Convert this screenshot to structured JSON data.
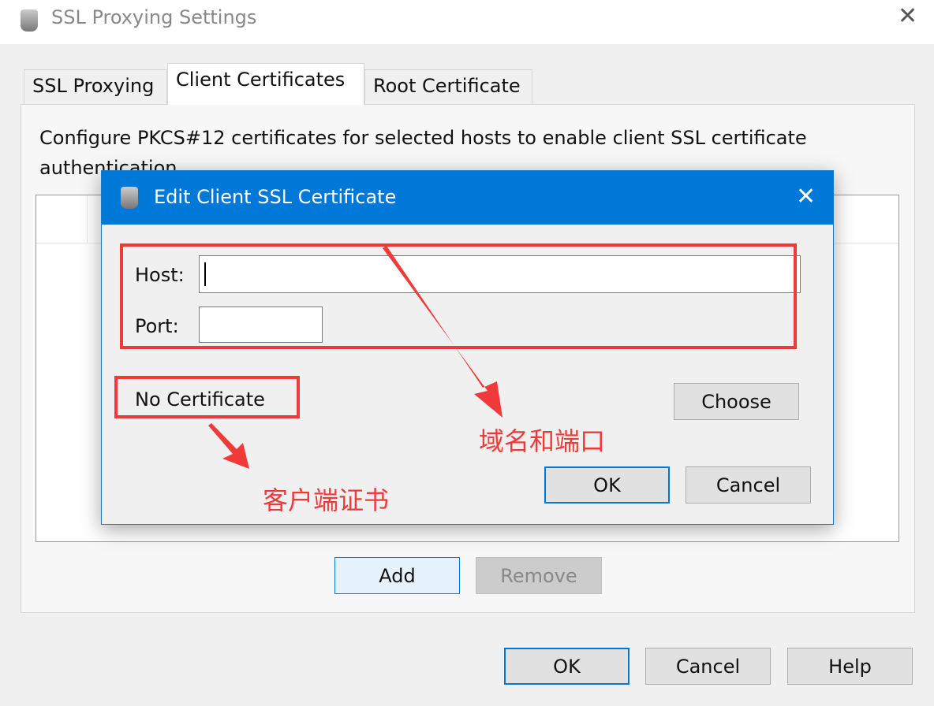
{
  "window": {
    "title": "SSL Proxying Settings",
    "icon": "charles-jug-icon",
    "close_icon": "close-icon"
  },
  "tabs": [
    {
      "label": "SSL Proxying"
    },
    {
      "label": "Client Certificates",
      "active": true
    },
    {
      "label": "Root Certificate"
    }
  ],
  "panel": {
    "description": "Configure PKCS#12 certificates for selected hosts to enable client SSL certificate authentication.",
    "add_label": "Add",
    "remove_label": "Remove"
  },
  "footer": {
    "ok_label": "OK",
    "cancel_label": "Cancel",
    "help_label": "Help"
  },
  "dialog": {
    "title": "Edit Client SSL Certificate",
    "host_label": "Host:",
    "host_value": "",
    "port_label": "Port:",
    "port_value": "",
    "certificate_status": "No Certificate",
    "choose_label": "Choose",
    "ok_label": "OK",
    "cancel_label": "Cancel"
  },
  "annotations": {
    "host_port": "域名和端口",
    "client_cert": "客户端证书",
    "color": "#f03a3a"
  },
  "colors": {
    "accent": "#0078d7"
  }
}
